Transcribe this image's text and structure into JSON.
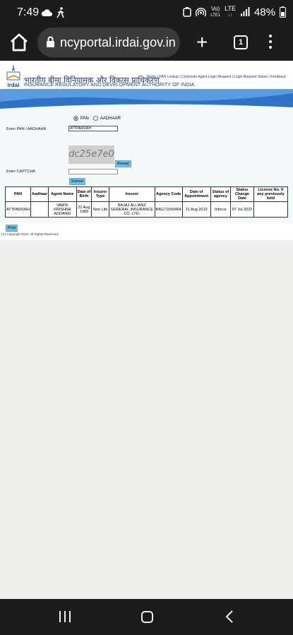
{
  "status_bar": {
    "time": "7:49",
    "left_icons": [
      "cloud-icon",
      "walking-person-icon"
    ],
    "right_icons": [
      "alarm-icon",
      "hotspot-icon",
      "signal-icon"
    ],
    "volte": "Vo)",
    "lte_top": "LTE",
    "lte_bottom": "LTE1",
    "battery": "48%"
  },
  "browser": {
    "url": "ncyportal.irdai.gov.in",
    "tab_count": "1"
  },
  "site": {
    "title_hindi": "भारतीय बीमा विनियामक और विकास प्राधिकरण",
    "title_english": "INSURANCE REGULATORY AND DEVELOPMENT AUTHORITY OF INDIA",
    "logo_text": "irdai",
    "top_links": "Home | PAN Lookup | Corporate Agent Login Request | Login Request Status | Feedback",
    "brand_color": "#2d6fd0"
  },
  "form": {
    "radio_pan": "PAN",
    "radio_aadhaar": "AADHAAR",
    "pan_label": "Enter PAN / AADHAAR",
    "pan_value": "ATTPA6506H",
    "captcha_text": "dc25e7e0",
    "reload_label": "Reload",
    "captcha_label": "Enter CAPTCHA",
    "captcha_value": "",
    "submit_label": "Submit"
  },
  "table": {
    "headers": [
      "PAN",
      "Aadhaar",
      "Agent Name",
      "Date of Birth",
      "Insurer Type",
      "Insurer",
      "Agency Code",
      "Date of Appointment",
      "Status of agency",
      "Status Change Date",
      "License No. If any previously held"
    ],
    "rows": [
      [
        "ATTPA6506H",
        "",
        "VAMSI KRISHNA ADDANKI",
        "21 Aug 1989",
        "Non Life",
        "BAJAJ ALLIANZ GENERAL INSURANCE CO. LTD.",
        "BAG71000464",
        "21 Aug 2019",
        "Inforce",
        "07 Jul 2022",
        ""
      ]
    ]
  },
  "print_label": "Print",
  "copyright": "(C) Copyright 2016. All Rights Reserved."
}
